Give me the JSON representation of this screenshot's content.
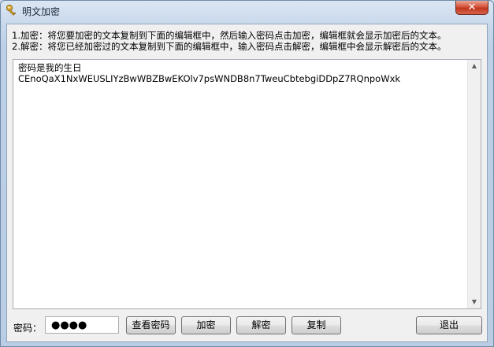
{
  "window": {
    "title": "明文加密",
    "close_label": "✕"
  },
  "instructions": {
    "line1": "1.加密：将您要加密的文本复制到下面的编辑框中，然后输入密码点击加密，编辑框就会显示加密后的文本。",
    "line2": "2.解密：将您已经加密过的文本复制到下面的编辑框中，输入密码点击解密，编辑框中会显示解密后的文本。"
  },
  "editor": {
    "content": "密码是我的生日\nCEnoQaX1NxWEUSLIYzBwWBZBwEKOlv7psWNDB8n7TweuCbtebgiDDpZ7RQnpoWxk"
  },
  "password": {
    "label": "密码：",
    "masked_value": "●●●●"
  },
  "buttons": {
    "view_password": "查看密码",
    "encrypt": "加密",
    "decrypt": "解密",
    "copy": "复制",
    "exit": "退出"
  },
  "icons": {
    "title_icon": "key-icon",
    "close_icon": "close-icon",
    "scroll_up": "arrow-up-icon",
    "scroll_down": "arrow-down-icon"
  },
  "colors": {
    "close_button": "#c1361e",
    "frame": "#bdd0e6"
  }
}
